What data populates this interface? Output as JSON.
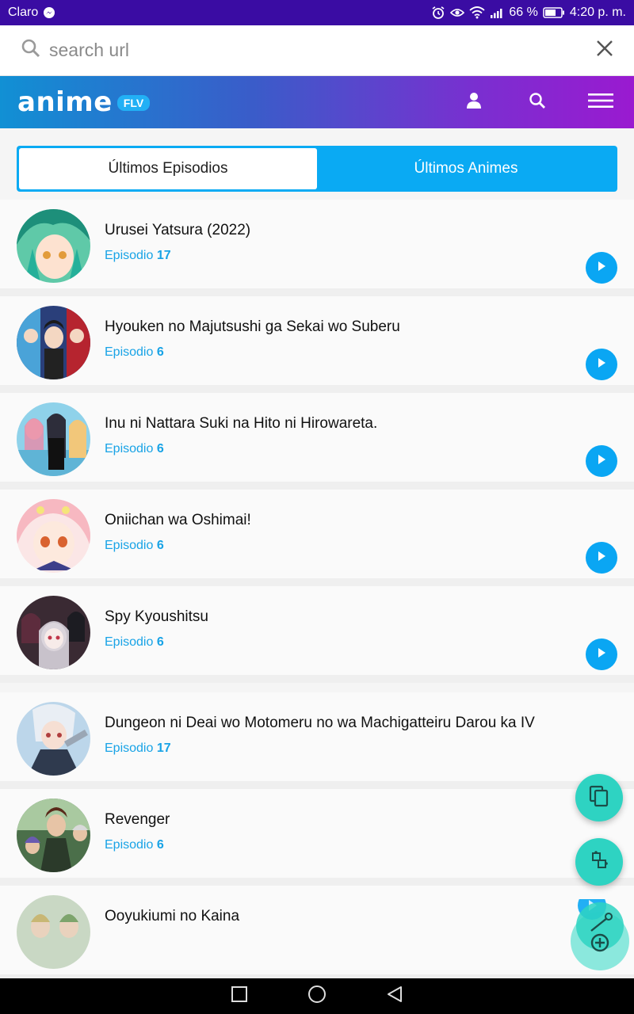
{
  "status_bar": {
    "carrier": "Claro",
    "battery": "66 %",
    "time": "4:20 p. m.",
    "icons": [
      "messenger-icon",
      "alarm-icon",
      "eye-icon",
      "wifi-icon",
      "signal-icon",
      "battery-icon"
    ]
  },
  "url_bar": {
    "placeholder": "search url",
    "icons": [
      "search-icon",
      "close-icon"
    ]
  },
  "header": {
    "logo_text": "anime",
    "logo_badge": "FLV",
    "icons": [
      "user-icon",
      "search-icon",
      "menu-icon"
    ],
    "colors": {
      "gradient_start": "#1190d4",
      "gradient_end": "#9a1ad0"
    }
  },
  "tabs": [
    {
      "label": "Últimos Episodios",
      "active": true
    },
    {
      "label": "Últimos Animes",
      "active": false
    }
  ],
  "episodes": [
    {
      "title": "Urusei Yatsura (2022)",
      "ep_label": "Episodio",
      "ep_num": "17"
    },
    {
      "title": "Hyouken no Majutsushi ga Sekai wo Suberu",
      "ep_label": "Episodio",
      "ep_num": "6"
    },
    {
      "title": "Inu ni Nattara Suki na Hito ni Hirowareta.",
      "ep_label": "Episodio",
      "ep_num": "6"
    },
    {
      "title": "Oniichan wa Oshimai!",
      "ep_label": "Episodio",
      "ep_num": "6"
    },
    {
      "title": "Spy Kyoushitsu",
      "ep_label": "Episodio",
      "ep_num": "6"
    },
    {
      "title": "Dungeon ni Deai wo Motomeru no wa Machigatteiru Darou ka IV",
      "ep_label": "Episodio",
      "ep_num": "17"
    },
    {
      "title": "Revenger",
      "ep_label": "Episodio",
      "ep_num": "6"
    },
    {
      "title": "Ooyukiumi no Kaina",
      "ep_label": "",
      "ep_num": ""
    }
  ],
  "fabs": [
    "copy-icon",
    "puzzle-icon",
    "tool-add-icon"
  ],
  "nav_bar": [
    "square-icon",
    "circle-icon",
    "back-triangle-icon"
  ],
  "colors": {
    "accent": "#0aa6f3",
    "fab": "#2ed3c2",
    "status_bar": "#3a0ca3"
  }
}
